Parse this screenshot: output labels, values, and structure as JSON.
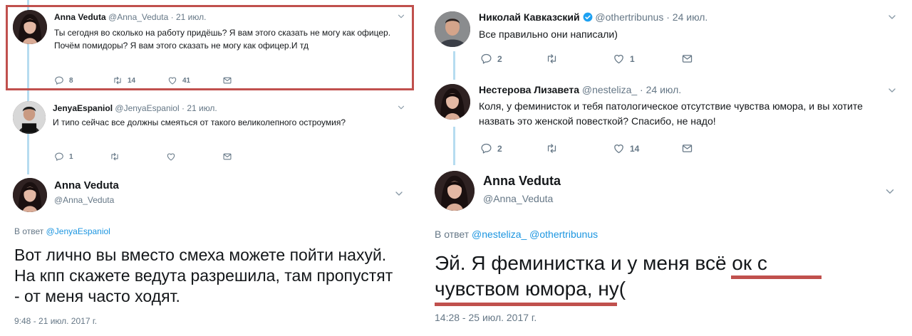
{
  "left": {
    "tweet1": {
      "name": "Anna Veduta",
      "handle": "@Anna_Veduta",
      "sep": "·",
      "time": "21 июл.",
      "text": "Ты сегодня во сколько на работу придёшь? Я вам этого сказать не могу как офицер. Почём помидоры? Я вам этого сказать не могу как офицер.И тд",
      "replies": "8",
      "retweets": "14",
      "likes": "41"
    },
    "tweet2": {
      "name": "JenyaEspaniol",
      "handle": "@JenyaEspaniol",
      "sep": "·",
      "time": "21 июл.",
      "text": "И типо сейчас все должны смеяться от такого великолепного остроумия?",
      "replies": "1",
      "retweets": "",
      "likes": ""
    },
    "main": {
      "name": "Anna Veduta",
      "handle": "@Anna_Veduta",
      "reply_prefix": "В ответ",
      "reply_to": "@JenyaEspaniol",
      "text": "Вот лично вы вместо смеха можете пойти нахуй. На кпп скажете ведута разрешила, там пропустят - от меня часто ходят.",
      "timestamp": "9:48 - 21 июл. 2017 г."
    }
  },
  "right": {
    "tweet1": {
      "name": "Николай Кавказский",
      "handle": "@othertribunus",
      "sep": "·",
      "time": "24 июл.",
      "text": "Все правильно они написали)",
      "replies": "2",
      "retweets": "",
      "likes": "1"
    },
    "tweet2": {
      "name": "Нестерова Лизавета",
      "handle": "@nesteliza_",
      "sep": "·",
      "time": "24 июл.",
      "text": "Коля, у феминисток и тебя патологическое отсутствие чувства юмора, и вы хотите назвать это женской повесткой? Спасибо, не надо!",
      "replies": "2",
      "retweets": "",
      "likes": "14"
    },
    "main": {
      "name": "Anna Veduta",
      "handle": "@Anna_Veduta",
      "reply_prefix": "В ответ",
      "reply_to": "@nesteliza_ @othertribunus",
      "text_line1": "Эй. Я феминистка и у меня всё ок с",
      "text_line2": "чувством юмора, ну(",
      "timestamp": "14:28 - 25 июл. 2017 г."
    }
  },
  "colors": {
    "text": "#14171a",
    "secondary": "#657786",
    "link": "#1b95e0",
    "thread_line": "#b6dcf0",
    "highlight": "#c0504d",
    "verified": "#1da1f2"
  },
  "icons": [
    "reply-icon",
    "retweet-icon",
    "like-icon",
    "dm-icon",
    "chevron-down-icon",
    "verified-badge-icon"
  ]
}
